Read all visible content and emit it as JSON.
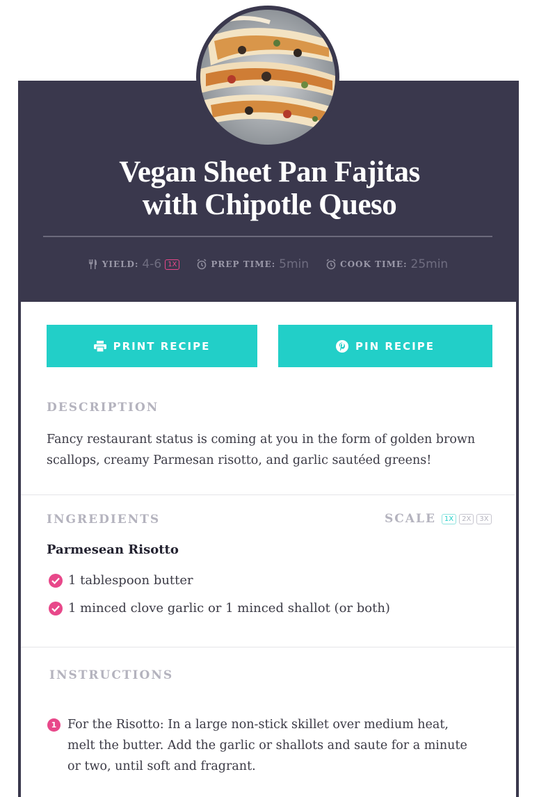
{
  "recipe": {
    "title_line1": "Vegan Sheet Pan Fajitas",
    "title_line2": "with Chipotle Queso",
    "photo_icon": "tacos-photo"
  },
  "meta": {
    "yield_label": "YIELD:",
    "yield_value": "4-6",
    "yield_scale": "1X",
    "prep_label": "PREP TIME:",
    "prep_value": "5min",
    "cook_label": "COOK TIME:",
    "cook_value": "25min",
    "icons": [
      "utensils-icon",
      "clock-icon",
      "clock-icon"
    ]
  },
  "buttons": {
    "print_label": "PRINT RECIPE",
    "pin_label": "PIN RECIPE"
  },
  "description": {
    "label": "DESCRIPTION",
    "line1": "Fancy restaurant status is coming at you in the form of golden brown",
    "line2": "scallops, creamy Parmesan risotto, and garlic sautéed greens!"
  },
  "ingredients": {
    "label": "INGREDIENTS",
    "scale_label": "SCALE",
    "scale_options": [
      "1X",
      "2X",
      "3X"
    ],
    "group_title": "Parmesean Risotto",
    "items": [
      "1 tablespoon butter",
      "1 minced clove garlic or 1 minced shallot (or both)"
    ]
  },
  "instructions": {
    "label": "INSTRUCTIONS",
    "steps": [
      {
        "number": "1",
        "line1": "For the Risotto: In a large non-stick skillet over medium heat,",
        "line2": "melt the butter. Add the garlic or shallots and saute for a minute",
        "line3": "or two, until soft and fragrant."
      }
    ]
  },
  "colors": {
    "header_bg": "#3a384d",
    "accent_teal": "#22cfc8",
    "accent_pink": "#e8488a"
  }
}
